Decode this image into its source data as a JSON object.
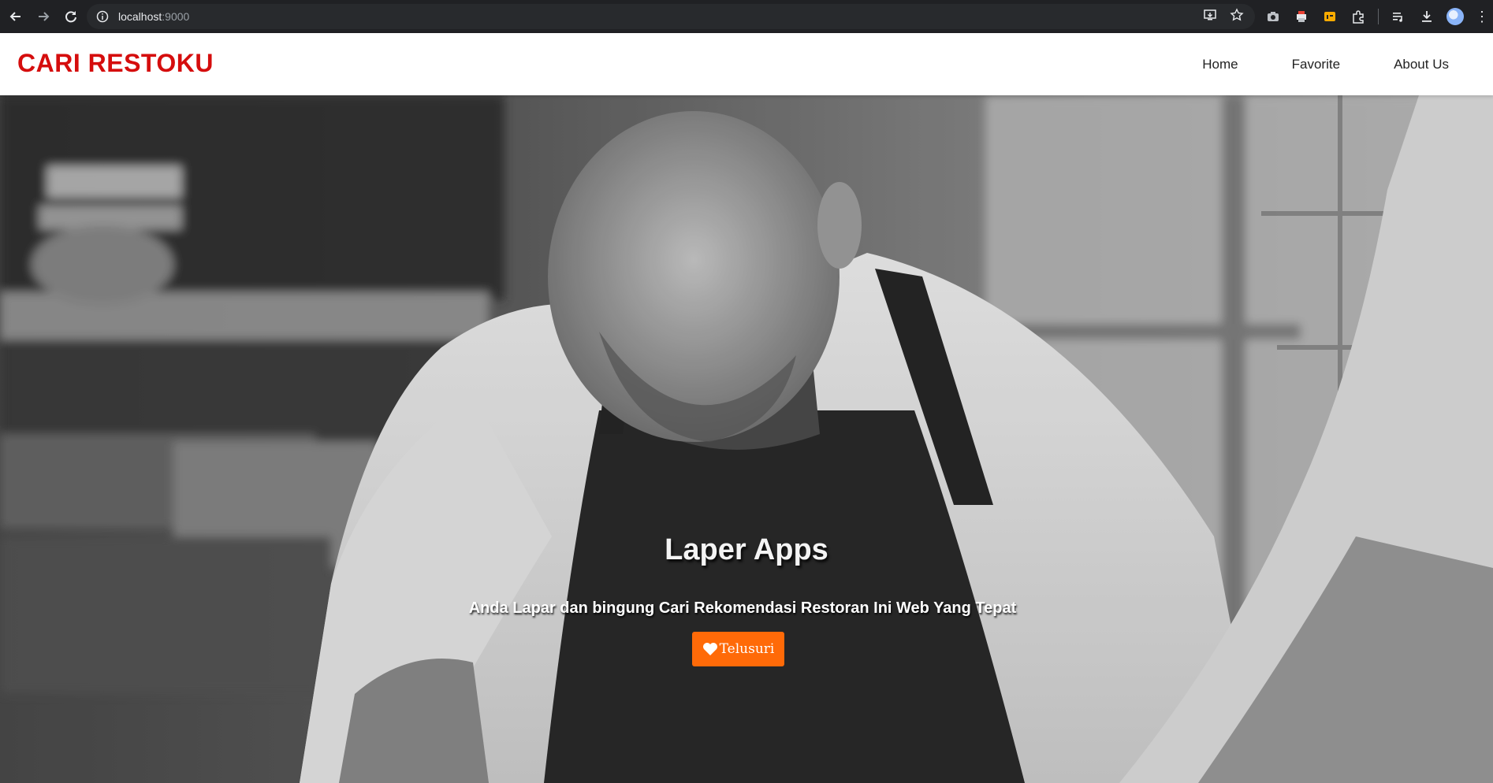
{
  "browser": {
    "url_host": "localhost",
    "url_port": ":9000",
    "icons": {
      "back": "arrow-left-icon",
      "forward": "arrow-right-icon",
      "reload": "reload-icon",
      "site_info": "info-icon",
      "install": "install-app-icon",
      "bookmark": "star-icon",
      "extensions": [
        "camera-icon",
        "printer-icon",
        "rss-icon",
        "puzzle-icon"
      ],
      "reading_list": "playlist-icon",
      "download": "download-icon",
      "profile": "avatar-icon",
      "menu": "kebab-menu-icon"
    }
  },
  "header": {
    "brand": "CARI RESTOKU",
    "brand_color": "#d50d0d",
    "nav": [
      {
        "label": "Home"
      },
      {
        "label": "Favorite"
      },
      {
        "label": "About Us"
      }
    ]
  },
  "hero": {
    "title": "Laper Apps",
    "subtitle": "Anda Lapar dan bingung Cari Rekomendasi Restoran Ini Web Yang Tepat",
    "button_label": "Telusuri",
    "button_icon": "heart-icon",
    "button_color": "#ff6a08"
  }
}
